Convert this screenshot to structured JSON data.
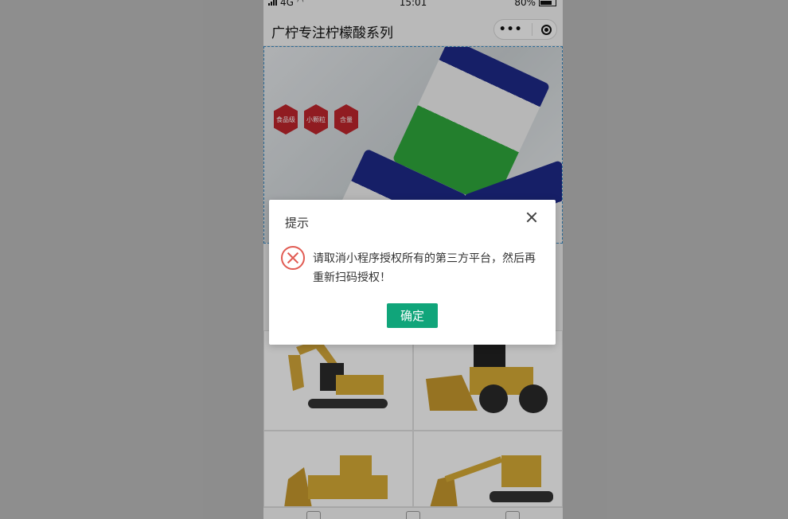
{
  "status_bar": {
    "network": "4G",
    "time": "15:01",
    "battery": "80%"
  },
  "nav": {
    "title": "广柠专注柠檬酸系列"
  },
  "banner": {
    "badges": [
      "食品级",
      "小颗粒",
      "含量"
    ]
  },
  "modal": {
    "title": "提示",
    "message": "请取消小程序授权所有的第三方平台，然后再重新扫码授权！",
    "confirm_label": "确定"
  },
  "colors": {
    "confirm": "#10a57a",
    "error": "#e15b53",
    "banner_badge": "#c0262d"
  }
}
